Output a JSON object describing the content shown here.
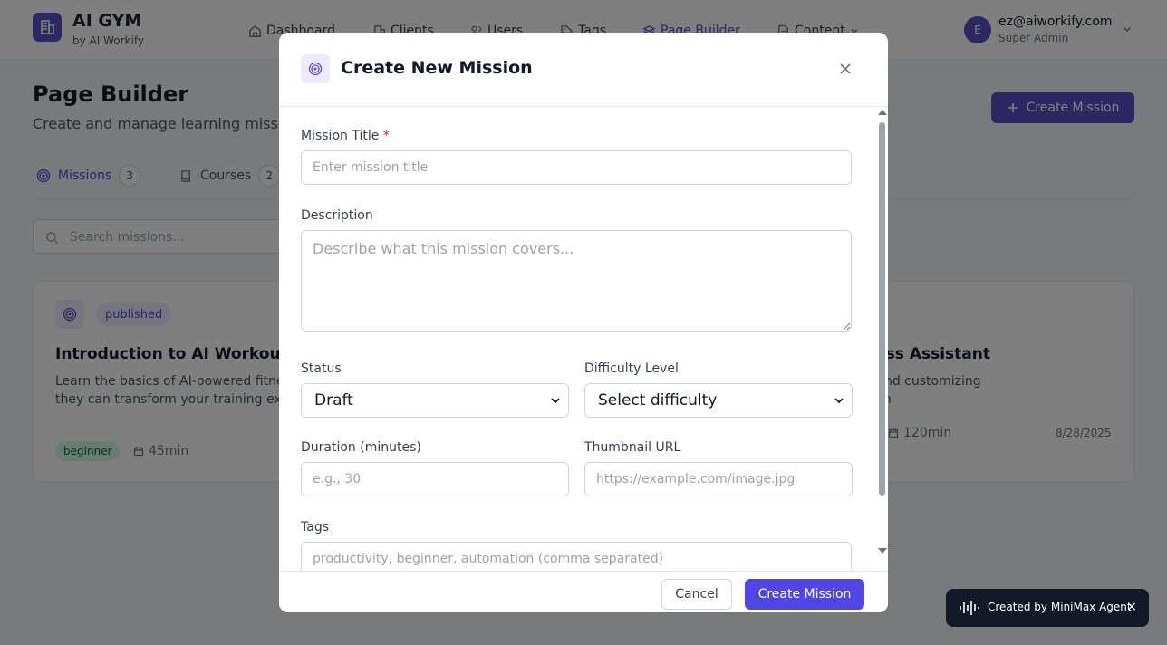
{
  "brand": {
    "title": "AI GYM",
    "subtitle": "by AI Workify"
  },
  "nav": {
    "items": [
      {
        "label": "Dashboard",
        "icon": "home-icon"
      },
      {
        "label": "Clients",
        "icon": "building-icon"
      },
      {
        "label": "Users",
        "icon": "users-icon"
      },
      {
        "label": "Tags",
        "icon": "tag-icon"
      },
      {
        "label": "Page Builder",
        "icon": "layers-icon",
        "active": true
      },
      {
        "label": "Content",
        "icon": "file-icon"
      }
    ]
  },
  "user": {
    "initial": "E",
    "email": "ez@aiworkify.com",
    "role": "Super Admin"
  },
  "page": {
    "title": "Page Builder",
    "subtitle": "Create and manage learning missions and courses"
  },
  "actions": {
    "create_mission": "Create Mission"
  },
  "tabs": [
    {
      "label": "Missions",
      "count": "3",
      "active": true
    },
    {
      "label": "Courses",
      "count": "2"
    }
  ],
  "search": {
    "placeholder": "Search missions..."
  },
  "cards": [
    {
      "status": "published",
      "title": "Introduction to AI Workouts",
      "description": "Learn the basics of AI-powered fitness and how they can transform your training experience",
      "difficulty": "beginner",
      "duration": "45min",
      "date": ""
    },
    {
      "status": "",
      "title": "",
      "description": "",
      "difficulty": "",
      "duration": "",
      "date": ""
    },
    {
      "status": "",
      "title": "our AI Fitness Assistant",
      "description": "de to creating and customizing\nl AI fitness coach",
      "difficulty": "",
      "duration": "120min",
      "date": "8/28/2025"
    }
  ],
  "modal": {
    "title": "Create New Mission",
    "fields": {
      "title": {
        "label": "Mission Title",
        "required_mark": "*",
        "placeholder": "Enter mission title"
      },
      "description": {
        "label": "Description",
        "placeholder": "Describe what this mission covers..."
      },
      "status": {
        "label": "Status",
        "value": "Draft"
      },
      "difficulty": {
        "label": "Difficulty Level",
        "value": "Select difficulty"
      },
      "duration": {
        "label": "Duration (minutes)",
        "placeholder": "e.g., 30"
      },
      "thumbnail": {
        "label": "Thumbnail URL",
        "placeholder": "https://example.com/image.jpg"
      },
      "tags": {
        "label": "Tags",
        "placeholder": "productivity, beginner, automation (comma separated)"
      }
    },
    "cancel": "Cancel",
    "submit": "Create Mission"
  },
  "toast": {
    "text": "Created by MiniMax Agent",
    "close": "×"
  }
}
